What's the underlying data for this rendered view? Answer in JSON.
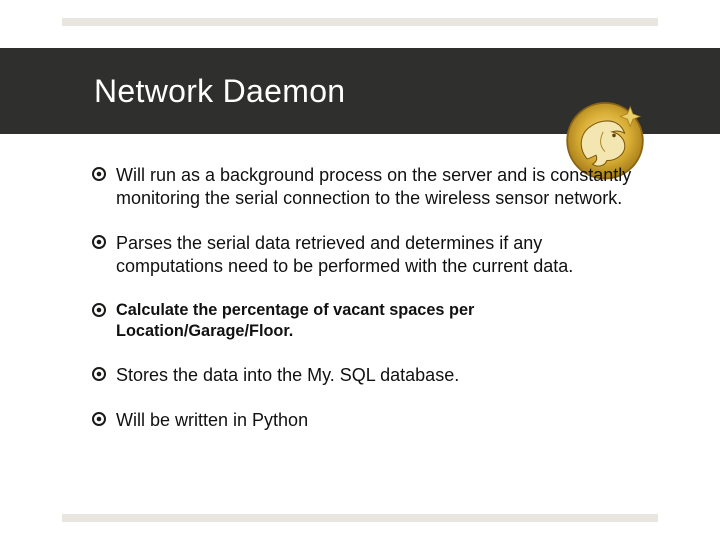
{
  "title": "Network Daemon",
  "bullets": [
    {
      "text": "Will run as a background process on the server and is constantly monitoring the serial connection to the wireless sensor network.",
      "small": false
    },
    {
      "text": "Parses the serial data retrieved and determines if any computations need to be performed with the current data.",
      "small": false
    },
    {
      "text": "Calculate the percentage of vacant spaces per Location/Garage/Floor.",
      "small": true
    },
    {
      "text": "Stores the data into the My. SQL database.",
      "small": false
    },
    {
      "text": "Will be written in Python",
      "small": false
    }
  ],
  "colors": {
    "titlebar": "#2f2f2d",
    "accentGold": "#c9a227",
    "accentGoldLight": "#e3be4d",
    "bulletMark": "#1a1a18"
  }
}
